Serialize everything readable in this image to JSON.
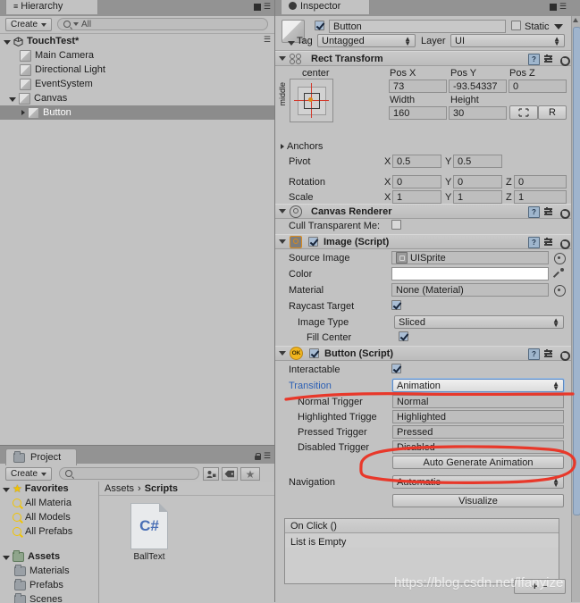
{
  "window": {
    "theme_bg": "#c2c2c2",
    "accent_blue": "#2b5fb4",
    "annotation_color": "#e8382a"
  },
  "hierarchy": {
    "tab_label": "Hierarchy",
    "tab_icon": "hierarchy-icon",
    "create_label": "Create",
    "search_placeholder": "All",
    "search_value": "All",
    "scene_name": "TouchTest*",
    "items": [
      {
        "label": "Main Camera",
        "depth": 1,
        "expandable": false,
        "selected": false
      },
      {
        "label": "Directional Light",
        "depth": 1,
        "expandable": false,
        "selected": false
      },
      {
        "label": "EventSystem",
        "depth": 1,
        "expandable": false,
        "selected": false
      },
      {
        "label": "Canvas",
        "depth": 1,
        "expandable": true,
        "expanded": true,
        "selected": false
      },
      {
        "label": "Button",
        "depth": 2,
        "expandable": true,
        "expanded": false,
        "selected": true
      }
    ]
  },
  "project": {
    "tab_label": "Project",
    "tab_icon": "folder-icon",
    "create_label": "Create",
    "search_placeholder": "",
    "lock_icon": "lock-icon",
    "menu_icon": "panel-menu-icon",
    "filter_icons": [
      "type-filter-icon",
      "label-filter-icon",
      "favorite-star-icon"
    ],
    "tree": [
      {
        "label": "Favorites",
        "icon": "star-icon",
        "header": true,
        "expanded": true
      },
      {
        "label": "All Materia",
        "icon": "search-icon",
        "header": false
      },
      {
        "label": "All Models",
        "icon": "search-icon",
        "header": false
      },
      {
        "label": "All Prefabs",
        "icon": "search-icon",
        "header": false
      },
      {
        "label": "Assets",
        "icon": "folder-icon",
        "header": true,
        "expanded": true
      },
      {
        "label": "Materials",
        "icon": "folder-icon",
        "header": false
      },
      {
        "label": "Prefabs",
        "icon": "folder-icon",
        "header": false
      },
      {
        "label": "Scenes",
        "icon": "folder-icon",
        "header": false
      }
    ],
    "breadcrumb": {
      "root": "Assets",
      "separator": "›",
      "current": "Scripts"
    },
    "assets": [
      {
        "name": "BallText",
        "kind": "C#",
        "icon": "csharp-script-icon"
      }
    ]
  },
  "inspector": {
    "tab_label": "Inspector",
    "tab_icon": "inspector-icon",
    "gameobject": {
      "enabled": true,
      "name": "Button",
      "static_label": "Static",
      "static_checked": false,
      "tag_label": "Tag",
      "tag_value": "Untagged",
      "layer_label": "Layer",
      "layer_value": "UI"
    },
    "rect_transform": {
      "title": "Rect Transform",
      "icon": "rect-transform-icon",
      "anchor_preset_h": "center",
      "anchor_preset_v": "middle",
      "pos_x_label": "Pos X",
      "pos_x": "73",
      "pos_y_label": "Pos Y",
      "pos_y": "-93.54337",
      "pos_z_label": "Pos Z",
      "pos_z": "0",
      "width_label": "Width",
      "width": "160",
      "height_label": "Height",
      "height": "30",
      "blueprint_icon": "blueprint-mode-icon",
      "raw_label": "R",
      "anchors_label": "Anchors",
      "pivot_label": "Pivot",
      "pivot_x": "0.5",
      "pivot_y": "0.5",
      "rotation_label": "Rotation",
      "rot_x": "0",
      "rot_y": "0",
      "rot_z": "0",
      "scale_label": "Scale",
      "scale_x": "1",
      "scale_y": "1",
      "scale_z": "1",
      "axis_x": "X",
      "axis_y": "Y",
      "axis_z": "Z"
    },
    "canvas_renderer": {
      "title": "Canvas Renderer",
      "icon": "canvas-renderer-icon",
      "cull_label": "Cull Transparent Me:",
      "cull_checked": false
    },
    "image": {
      "title": "Image (Script)",
      "icon": "image-component-icon",
      "enabled": true,
      "source_image_label": "Source Image",
      "source_image_value": "UISprite",
      "color_label": "Color",
      "color_value": "#ffffff",
      "material_label": "Material",
      "material_value": "None (Material)",
      "raycast_label": "Raycast Target",
      "raycast_checked": true,
      "image_type_label": "Image Type",
      "image_type_value": "Sliced",
      "fill_center_label": "Fill Center",
      "fill_center_checked": true
    },
    "button": {
      "title": "Button (Script)",
      "icon": "button-component-icon",
      "enabled": true,
      "interactable_label": "Interactable",
      "interactable_checked": true,
      "transition_label": "Transition",
      "transition_value": "Animation",
      "normal_trigger_label": "Normal Trigger",
      "normal_trigger_value": "Normal",
      "highlighted_trigger_label": "Highlighted Trigge",
      "highlighted_trigger_value": "Highlighted",
      "pressed_trigger_label": "Pressed Trigger",
      "pressed_trigger_value": "Pressed",
      "disabled_trigger_label": "Disabled Trigger",
      "disabled_trigger_value": "Disabled",
      "auto_generate_label": "Auto Generate Animation",
      "navigation_label": "Navigation",
      "navigation_value": "Automatic",
      "visualize_label": "Visualize",
      "onclick_header": "On Click ()",
      "onclick_empty": "List is Empty",
      "add_label": "+",
      "remove_label": "−"
    }
  },
  "watermark": {
    "text": "https://blog.csdn.net/lfanyize"
  }
}
